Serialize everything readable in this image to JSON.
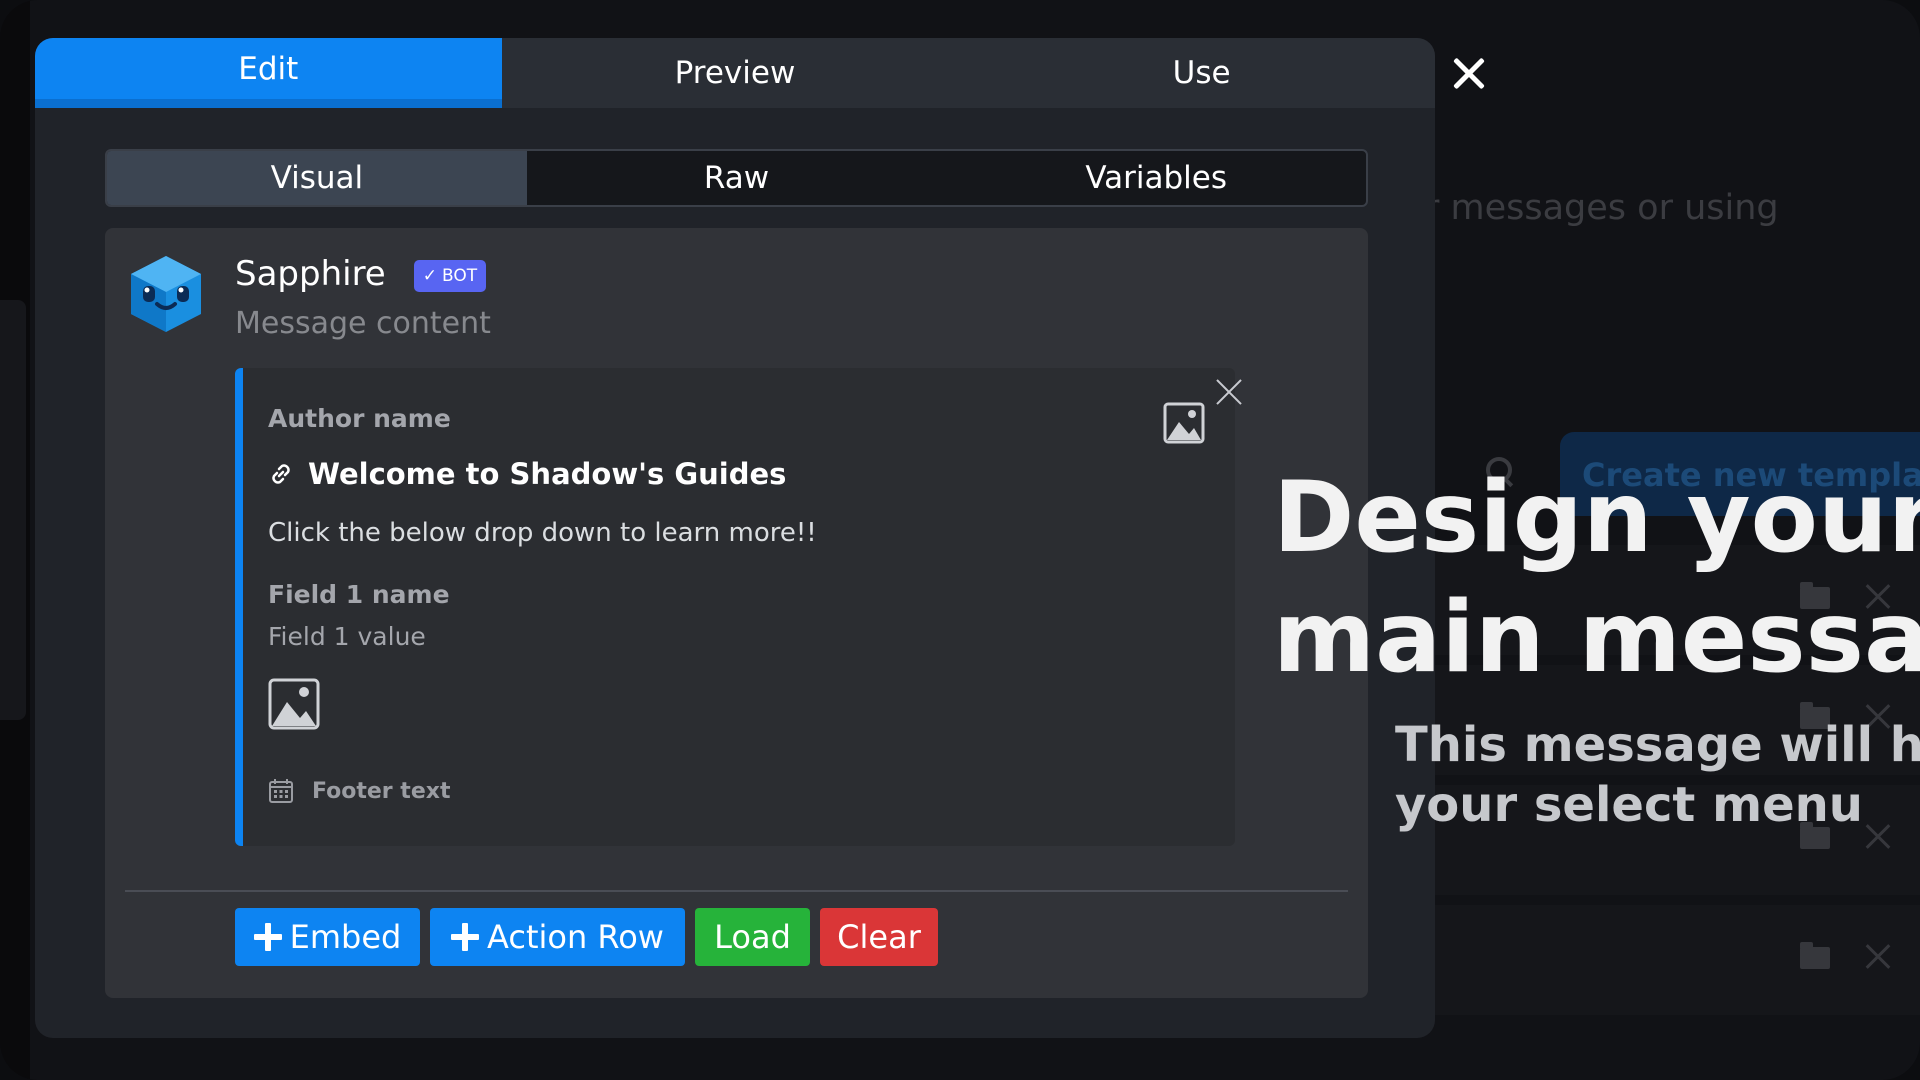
{
  "main_tabs": [
    {
      "label": "Edit",
      "active": true
    },
    {
      "label": "Preview",
      "active": false
    },
    {
      "label": "Use",
      "active": false
    }
  ],
  "sub_tabs": [
    {
      "label": "Visual",
      "active": true
    },
    {
      "label": "Raw",
      "active": false
    },
    {
      "label": "Variables",
      "active": false
    }
  ],
  "message": {
    "bot_name": "Sapphire",
    "badge": "BOT",
    "content_placeholder": "Message content"
  },
  "embed": {
    "author": "Author name",
    "title": "Welcome to Shadow's Guides",
    "description": "Click the below drop down to learn more!!",
    "field_name": "Field 1 name",
    "field_value": "Field 1 value",
    "footer": "Footer text",
    "accent_color": "#0d84f2"
  },
  "buttons": {
    "embed": "Embed",
    "action_row": "Action Row",
    "load": "Load",
    "clear": "Clear"
  },
  "overlay": {
    "heading_line1": "Design your",
    "heading_line2": "main message",
    "sub_line1": "This message will have",
    "sub_line2": "your select menu"
  },
  "background": {
    "partial_text": "r messages or using",
    "create_button": "Create new template"
  },
  "icons": [
    "close-icon",
    "link-icon",
    "image-icon",
    "calendar-icon",
    "plus-icon",
    "search-icon",
    "folder-icon"
  ]
}
